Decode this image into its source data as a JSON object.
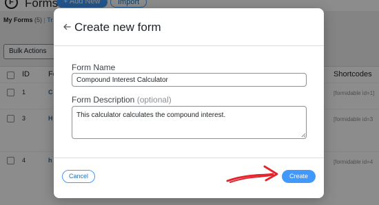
{
  "background": {
    "logo": "F",
    "title": "Forms",
    "add_new": "+ Add New",
    "import": "Import",
    "subnav": {
      "my_forms": "My Forms",
      "count": "(5)",
      "sep": "|",
      "trash": "Tr"
    },
    "bulk_actions": "Bulk Actions",
    "table": {
      "col_id": "ID",
      "col_form": "Fo",
      "col_shortcodes": "Shortcodes",
      "rows": [
        {
          "id": "1",
          "name": "C",
          "shortcode": "[formidable id=1]"
        },
        {
          "id": "3",
          "name": "H",
          "shortcode": "[formidable id=3"
        },
        {
          "id": "4",
          "name": "h",
          "shortcode": "[formidable id=4"
        }
      ]
    }
  },
  "modal": {
    "title": "Create new form",
    "back_icon": "arrow-left-icon",
    "form_name": {
      "label": "Form Name",
      "value": "Compound Interest Calculator"
    },
    "form_description": {
      "label": "Form Description",
      "optional": "(optional)",
      "value": "This calculator calculates the compound interest."
    },
    "cancel_label": "Cancel",
    "create_label": "Create"
  },
  "colors": {
    "accent": "#4199fd",
    "annotation_arrow": "#e3262d",
    "overlay": "rgba(0,0,0,0.45)"
  }
}
